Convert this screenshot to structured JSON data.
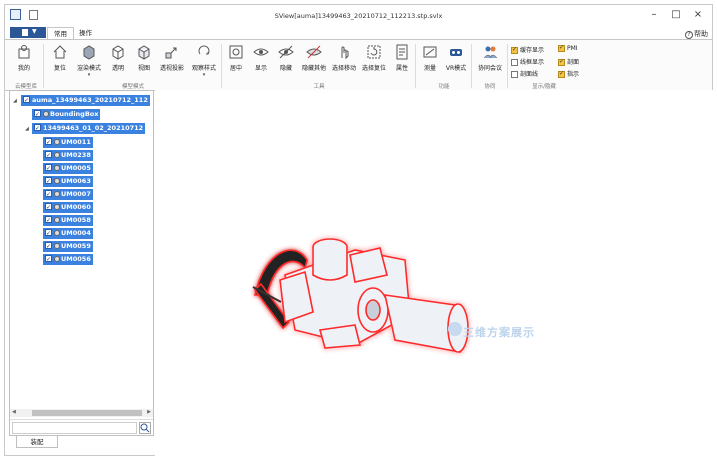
{
  "window": {
    "title": "SView[auma]13499463_20210712_112213.stp.svlx",
    "minimize": "–",
    "maximize": "□",
    "close": "×",
    "help": "帮助"
  },
  "tabs": [
    {
      "label": "常用",
      "active": true
    },
    {
      "label": "操作",
      "active": false
    }
  ],
  "ribbon": {
    "groups": [
      "云模型库",
      "模型模式",
      "工具",
      "功能",
      "协同",
      "显示/隐藏"
    ],
    "buttons": {
      "mine": "我的",
      "reset": "复位",
      "render": "渲染模式",
      "perspective": "透明",
      "view": "视图",
      "display_mode": "透视投影",
      "view_style": "观察样式",
      "center": "居中",
      "show": "显示",
      "hide": "隐藏",
      "hide_others": "隐藏其他",
      "select_move": "选择移动",
      "select_reset": "选择复位",
      "properties": "属性",
      "measure": "测量",
      "vr": "VR模式",
      "meeting": "协同会议"
    },
    "checks": [
      {
        "label": "缓存显示",
        "on": true
      },
      {
        "label": "PMI",
        "on": true
      },
      {
        "label": "线框显示",
        "on": false
      },
      {
        "label": "剖面",
        "on": true
      },
      {
        "label": "剖面线",
        "on": false
      },
      {
        "label": "指示",
        "on": true
      }
    ]
  },
  "tree": {
    "root": "auma_13499463_20210712_112",
    "bounding": "BoundingBox",
    "sub": "13499463_01_02_20210712",
    "parts": [
      "UM0011",
      "UM0238",
      "UM0005",
      "UM0063",
      "UM0007",
      "UM0060",
      "UM0058",
      "UM0004",
      "UM0059",
      "UM0056"
    ],
    "search_placeholder": ""
  },
  "bottom_tab": "装配",
  "watermark": "三维方案展示",
  "colors": {
    "accent": "#2b5797",
    "selection": "#3b82e0",
    "highlight": "#ff2a2a"
  }
}
